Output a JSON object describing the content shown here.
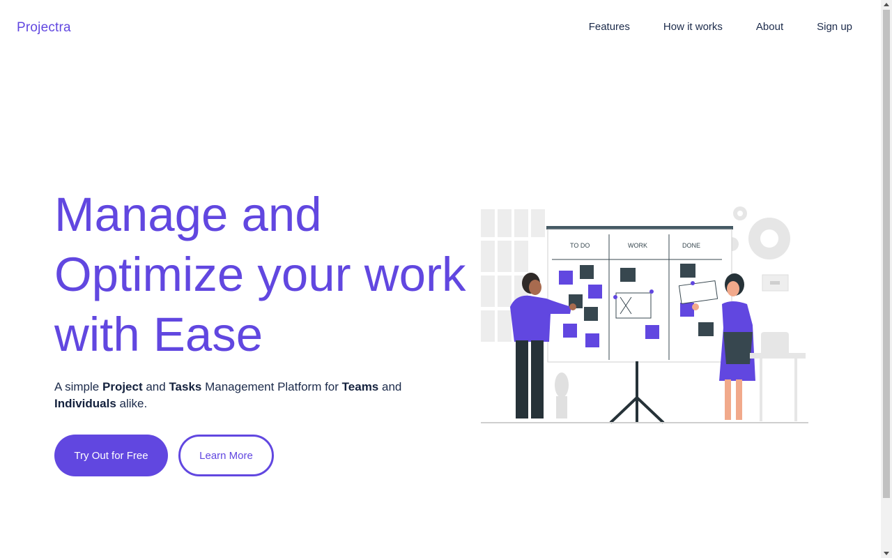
{
  "brand": "Projectra",
  "nav": {
    "items": [
      {
        "label": "Features"
      },
      {
        "label": "How it works"
      },
      {
        "label": "About"
      },
      {
        "label": "Sign up"
      }
    ]
  },
  "hero": {
    "title_lines": [
      "Manage and",
      "Optimize your work",
      "with Ease"
    ],
    "subtitle": {
      "t1": "A simple ",
      "b1": "Project",
      "t2": " and ",
      "b2": "Tasks",
      "t3": " Management Platform for ",
      "b3": "Teams",
      "t4": " and ",
      "b4": "Individuals",
      "t5": " alike."
    },
    "primary_button": "Try Out for Free",
    "secondary_button": "Learn More"
  },
  "board": {
    "columns": [
      "TO DO",
      "WORK",
      "DONE"
    ]
  },
  "colors": {
    "accent": "#6147e0",
    "text": "#1b2a4a",
    "dark_note": "#37474f",
    "gray": "#e6e6e6"
  }
}
